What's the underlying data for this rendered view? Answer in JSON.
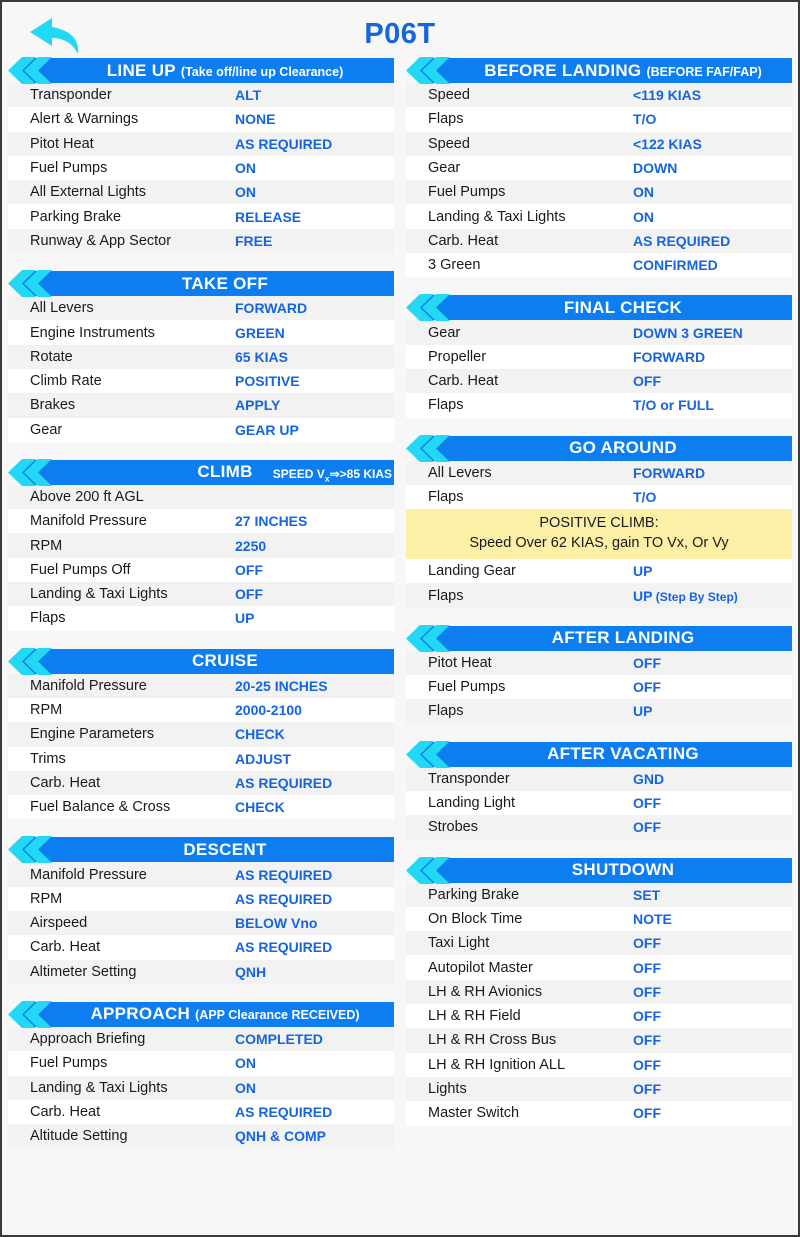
{
  "header": {
    "title": "P06T",
    "back_icon": "back-arrow-icon",
    "accent_blue": "#0c7ef2",
    "value_blue": "#1565e0",
    "chevron_cyan": "#22d8f5",
    "note_yellow": "#fbf0a6"
  },
  "left_column": [
    {
      "id": "line-up",
      "title": "LINE UP",
      "subtitle": "(Take off/line up Clearance)",
      "rows": [
        {
          "label": "Transponder",
          "value": "ALT"
        },
        {
          "label": "Alert & Warnings",
          "value": "NONE"
        },
        {
          "label": "Pitot Heat",
          "value": "AS REQUIRED"
        },
        {
          "label": "Fuel Pumps",
          "value": "ON"
        },
        {
          "label": "All External Lights",
          "value": "ON"
        },
        {
          "label": "Parking  Brake",
          "value": "RELEASE"
        },
        {
          "label": "Runway & App Sector",
          "value": "FREE"
        }
      ]
    },
    {
      "id": "take-off",
      "title": "TAKE OFF",
      "subtitle": "",
      "rows": [
        {
          "label": "All Levers",
          "value": "FORWARD"
        },
        {
          "label": "Engine Instruments",
          "value": "GREEN"
        },
        {
          "label": "Rotate",
          "value": "65 KIAS"
        },
        {
          "label": "Climb Rate",
          "value": "POSITIVE"
        },
        {
          "label": "Brakes",
          "value": "APPLY"
        },
        {
          "label": "Gear",
          "value": "GEAR UP"
        }
      ]
    },
    {
      "id": "climb",
      "title": "CLIMB",
      "subtitle": "SPEED Vx⇒>85 KIAS",
      "subtitle_right": true,
      "rows": [
        {
          "label": "Above 200 ft AGL",
          "value": ""
        },
        {
          "label": "Manifold Pressure",
          "value": "27 INCHES"
        },
        {
          "label": "RPM",
          "value": "2250"
        },
        {
          "label": "Fuel Pumps Off",
          "value": "OFF"
        },
        {
          "label": "Landing & Taxi Lights",
          "value": "OFF"
        },
        {
          "label": "Flaps",
          "value": "UP"
        }
      ]
    },
    {
      "id": "cruise",
      "title": "CRUISE",
      "subtitle": "",
      "rows": [
        {
          "label": "Manifold Pressure",
          "value": "20-25 INCHES"
        },
        {
          "label": "RPM",
          "value": "2000-2100"
        },
        {
          "label": "Engine Parameters",
          "value": "CHECK"
        },
        {
          "label": "Trims",
          "value": "ADJUST"
        },
        {
          "label": "Carb. Heat",
          "value": "AS REQUIRED"
        },
        {
          "label": "Fuel Balance & Cross",
          "value": "CHECK"
        }
      ]
    },
    {
      "id": "descent",
      "title": "DESCENT",
      "subtitle": "",
      "rows": [
        {
          "label": "Manifold Pressure",
          "value": "AS REQUIRED"
        },
        {
          "label": "RPM",
          "value": "AS REQUIRED"
        },
        {
          "label": "Airspeed",
          "value": "BELOW Vno"
        },
        {
          "label": "Carb. Heat",
          "value": "AS REQUIRED"
        },
        {
          "label": "Altimeter Setting",
          "value": "QNH"
        }
      ]
    },
    {
      "id": "approach",
      "title": "APPROACH",
      "subtitle": "(APP Clearance RECEIVED)",
      "rows": [
        {
          "label": "Approach Briefing",
          "value": "COMPLETED"
        },
        {
          "label": "Fuel Pumps",
          "value": "ON"
        },
        {
          "label": "Landing & Taxi Lights",
          "value": "ON"
        },
        {
          "label": "Carb. Heat",
          "value": "AS REQUIRED"
        },
        {
          "label": "Altitude Setting",
          "value": "QNH & COMP"
        }
      ]
    }
  ],
  "right_column": [
    {
      "id": "before-landing",
      "title": "BEFORE LANDING",
      "subtitle": "(BEFORE FAF/FAP)",
      "rows": [
        {
          "label": "Speed",
          "value": "<119 KIAS"
        },
        {
          "label": "Flaps",
          "value": "T/O"
        },
        {
          "label": "Speed",
          "value": "<122 KIAS"
        },
        {
          "label": "Gear",
          "value": "DOWN"
        },
        {
          "label": "Fuel Pumps",
          "value": "ON"
        },
        {
          "label": "Landing & Taxi Lights",
          "value": "ON"
        },
        {
          "label": "Carb. Heat",
          "value": "AS REQUIRED"
        },
        {
          "label": "3 Green",
          "value": "CONFIRMED"
        }
      ]
    },
    {
      "id": "final-check",
      "title": "FINAL CHECK",
      "subtitle": "",
      "rows": [
        {
          "label": "Gear",
          "value": "DOWN 3 GREEN"
        },
        {
          "label": "Propeller",
          "value": "FORWARD"
        },
        {
          "label": "Carb. Heat",
          "value": "OFF"
        },
        {
          "label": "Flaps",
          "value": "T/O or FULL"
        }
      ]
    },
    {
      "id": "go-around",
      "title": "GO AROUND",
      "subtitle": "",
      "rows": [
        {
          "label": "All Levers",
          "value": "FORWARD"
        },
        {
          "label": "Flaps",
          "value": "T/O"
        },
        {
          "note": true,
          "line1": "POSITIVE CLIMB:",
          "line2": "Speed Over 62 KIAS, gain TO Vx, Or Vy"
        },
        {
          "label": "Landing Gear",
          "value": "UP"
        },
        {
          "label": "Flaps",
          "value": "UP",
          "value_sub": " (Step By Step)"
        }
      ]
    },
    {
      "id": "after-landing",
      "title": "AFTER LANDING",
      "subtitle": "",
      "rows": [
        {
          "label": "Pitot Heat",
          "value": "OFF"
        },
        {
          "label": "Fuel Pumps",
          "value": "OFF"
        },
        {
          "label": "Flaps",
          "value": "UP"
        }
      ]
    },
    {
      "id": "after-vacating",
      "title": "AFTER VACATING",
      "subtitle": "",
      "rows": [
        {
          "label": "Transponder",
          "value": "GND"
        },
        {
          "label": "Landing Light",
          "value": "OFF"
        },
        {
          "label": "Strobes",
          "value": "OFF"
        }
      ]
    },
    {
      "id": "shutdown",
      "title": "SHUTDOWN",
      "subtitle": "",
      "rows": [
        {
          "label": "Parking Brake",
          "value": "SET"
        },
        {
          "label": "On Block Time",
          "value": "NOTE"
        },
        {
          "label": "Taxi Light",
          "value": "OFF"
        },
        {
          "label": "Autopilot Master",
          "value": "OFF"
        },
        {
          "label": "LH & RH Avionics",
          "value": "OFF"
        },
        {
          "label": "LH & RH Field",
          "value": "OFF"
        },
        {
          "label": "LH & RH Cross Bus",
          "value": "OFF"
        },
        {
          "label": "LH & RH Ignition ALL",
          "value": "OFF"
        },
        {
          "label": "Lights",
          "value": "OFF"
        },
        {
          "label": "Master Switch",
          "value": "OFF"
        }
      ]
    }
  ]
}
